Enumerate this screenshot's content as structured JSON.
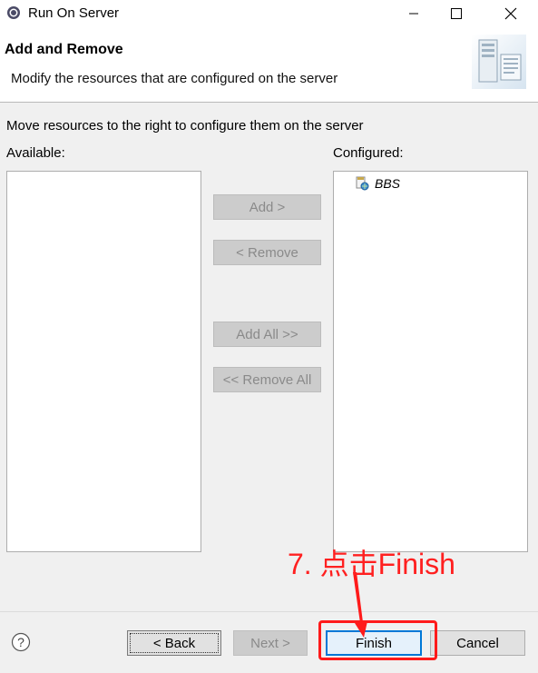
{
  "window": {
    "title": "Run On Server",
    "controls": {
      "minimize": "–",
      "maximize": "□",
      "close": "✕"
    }
  },
  "header": {
    "title": "Add and Remove",
    "description": "Modify the resources that are configured on the server",
    "banner_icon": "server-banner-icon"
  },
  "main": {
    "instruction": "Move resources to the right to configure them on the server",
    "available_label": "Available:",
    "configured_label": "Configured:",
    "available_items": [],
    "configured_items": [
      {
        "label": "BBS",
        "icon": "web-project-icon"
      }
    ],
    "buttons": {
      "add": "Add >",
      "remove": "< Remove",
      "add_all": "Add All >>",
      "remove_all": "<< Remove All"
    }
  },
  "footer": {
    "help_icon": "?",
    "back": "< Back",
    "next": "Next >",
    "finish": "Finish",
    "cancel": "Cancel"
  },
  "annotation": {
    "text": "7. 点击Finish",
    "color": "#ff2020"
  },
  "colors": {
    "accent": "#0078d7",
    "annotation_red": "#ff1a1a",
    "disabled_button": "#cccccc"
  }
}
